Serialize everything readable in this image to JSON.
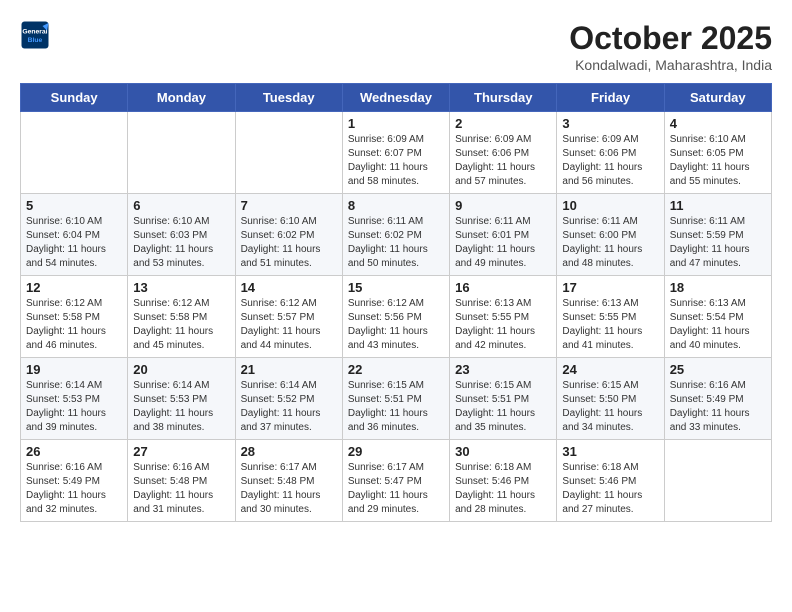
{
  "header": {
    "logo_line1": "General",
    "logo_line2": "Blue",
    "title": "October 2025",
    "subtitle": "Kondalwadi, Maharashtra, India"
  },
  "days_of_week": [
    "Sunday",
    "Monday",
    "Tuesday",
    "Wednesday",
    "Thursday",
    "Friday",
    "Saturday"
  ],
  "weeks": [
    [
      {
        "day": "",
        "info": ""
      },
      {
        "day": "",
        "info": ""
      },
      {
        "day": "",
        "info": ""
      },
      {
        "day": "1",
        "info": "Sunrise: 6:09 AM\nSunset: 6:07 PM\nDaylight: 11 hours and 58 minutes."
      },
      {
        "day": "2",
        "info": "Sunrise: 6:09 AM\nSunset: 6:06 PM\nDaylight: 11 hours and 57 minutes."
      },
      {
        "day": "3",
        "info": "Sunrise: 6:09 AM\nSunset: 6:06 PM\nDaylight: 11 hours and 56 minutes."
      },
      {
        "day": "4",
        "info": "Sunrise: 6:10 AM\nSunset: 6:05 PM\nDaylight: 11 hours and 55 minutes."
      }
    ],
    [
      {
        "day": "5",
        "info": "Sunrise: 6:10 AM\nSunset: 6:04 PM\nDaylight: 11 hours and 54 minutes."
      },
      {
        "day": "6",
        "info": "Sunrise: 6:10 AM\nSunset: 6:03 PM\nDaylight: 11 hours and 53 minutes."
      },
      {
        "day": "7",
        "info": "Sunrise: 6:10 AM\nSunset: 6:02 PM\nDaylight: 11 hours and 51 minutes."
      },
      {
        "day": "8",
        "info": "Sunrise: 6:11 AM\nSunset: 6:02 PM\nDaylight: 11 hours and 50 minutes."
      },
      {
        "day": "9",
        "info": "Sunrise: 6:11 AM\nSunset: 6:01 PM\nDaylight: 11 hours and 49 minutes."
      },
      {
        "day": "10",
        "info": "Sunrise: 6:11 AM\nSunset: 6:00 PM\nDaylight: 11 hours and 48 minutes."
      },
      {
        "day": "11",
        "info": "Sunrise: 6:11 AM\nSunset: 5:59 PM\nDaylight: 11 hours and 47 minutes."
      }
    ],
    [
      {
        "day": "12",
        "info": "Sunrise: 6:12 AM\nSunset: 5:58 PM\nDaylight: 11 hours and 46 minutes."
      },
      {
        "day": "13",
        "info": "Sunrise: 6:12 AM\nSunset: 5:58 PM\nDaylight: 11 hours and 45 minutes."
      },
      {
        "day": "14",
        "info": "Sunrise: 6:12 AM\nSunset: 5:57 PM\nDaylight: 11 hours and 44 minutes."
      },
      {
        "day": "15",
        "info": "Sunrise: 6:12 AM\nSunset: 5:56 PM\nDaylight: 11 hours and 43 minutes."
      },
      {
        "day": "16",
        "info": "Sunrise: 6:13 AM\nSunset: 5:55 PM\nDaylight: 11 hours and 42 minutes."
      },
      {
        "day": "17",
        "info": "Sunrise: 6:13 AM\nSunset: 5:55 PM\nDaylight: 11 hours and 41 minutes."
      },
      {
        "day": "18",
        "info": "Sunrise: 6:13 AM\nSunset: 5:54 PM\nDaylight: 11 hours and 40 minutes."
      }
    ],
    [
      {
        "day": "19",
        "info": "Sunrise: 6:14 AM\nSunset: 5:53 PM\nDaylight: 11 hours and 39 minutes."
      },
      {
        "day": "20",
        "info": "Sunrise: 6:14 AM\nSunset: 5:53 PM\nDaylight: 11 hours and 38 minutes."
      },
      {
        "day": "21",
        "info": "Sunrise: 6:14 AM\nSunset: 5:52 PM\nDaylight: 11 hours and 37 minutes."
      },
      {
        "day": "22",
        "info": "Sunrise: 6:15 AM\nSunset: 5:51 PM\nDaylight: 11 hours and 36 minutes."
      },
      {
        "day": "23",
        "info": "Sunrise: 6:15 AM\nSunset: 5:51 PM\nDaylight: 11 hours and 35 minutes."
      },
      {
        "day": "24",
        "info": "Sunrise: 6:15 AM\nSunset: 5:50 PM\nDaylight: 11 hours and 34 minutes."
      },
      {
        "day": "25",
        "info": "Sunrise: 6:16 AM\nSunset: 5:49 PM\nDaylight: 11 hours and 33 minutes."
      }
    ],
    [
      {
        "day": "26",
        "info": "Sunrise: 6:16 AM\nSunset: 5:49 PM\nDaylight: 11 hours and 32 minutes."
      },
      {
        "day": "27",
        "info": "Sunrise: 6:16 AM\nSunset: 5:48 PM\nDaylight: 11 hours and 31 minutes."
      },
      {
        "day": "28",
        "info": "Sunrise: 6:17 AM\nSunset: 5:48 PM\nDaylight: 11 hours and 30 minutes."
      },
      {
        "day": "29",
        "info": "Sunrise: 6:17 AM\nSunset: 5:47 PM\nDaylight: 11 hours and 29 minutes."
      },
      {
        "day": "30",
        "info": "Sunrise: 6:18 AM\nSunset: 5:46 PM\nDaylight: 11 hours and 28 minutes."
      },
      {
        "day": "31",
        "info": "Sunrise: 6:18 AM\nSunset: 5:46 PM\nDaylight: 11 hours and 27 minutes."
      },
      {
        "day": "",
        "info": ""
      }
    ]
  ]
}
